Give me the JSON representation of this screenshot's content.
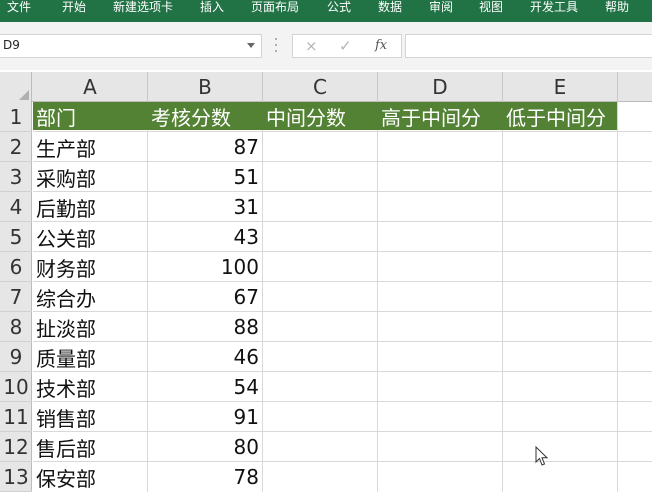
{
  "ribbon": {
    "tabs": [
      "文件",
      "开始",
      "新建选项卡",
      "插入",
      "页面布局",
      "公式",
      "数据",
      "审阅",
      "视图",
      "开发工具",
      "帮助"
    ],
    "color": "#217346"
  },
  "name_box": {
    "value": "D9"
  },
  "formula_bar": {
    "cancel_icon": "×",
    "enter_icon": "✓",
    "function_icon": "fx",
    "value": ""
  },
  "columns": [
    "A",
    "B",
    "C",
    "D",
    "E"
  ],
  "rows": [
    "1",
    "2",
    "3",
    "4",
    "5",
    "6",
    "7",
    "8",
    "9",
    "10",
    "11",
    "12",
    "13"
  ],
  "table": {
    "header_fill": "#548235",
    "headers": [
      "部门",
      "考核分数",
      "中间分数",
      "高于中间分",
      "低于中间分"
    ],
    "departments": [
      "生产部",
      "采购部",
      "后勤部",
      "公关部",
      "财务部",
      "综合办",
      "扯淡部",
      "质量部",
      "技术部",
      "销售部",
      "售后部",
      "保安部"
    ],
    "scores": [
      "87",
      "51",
      "31",
      "43",
      "100",
      "67",
      "88",
      "46",
      "54",
      "91",
      "80",
      "78"
    ]
  }
}
